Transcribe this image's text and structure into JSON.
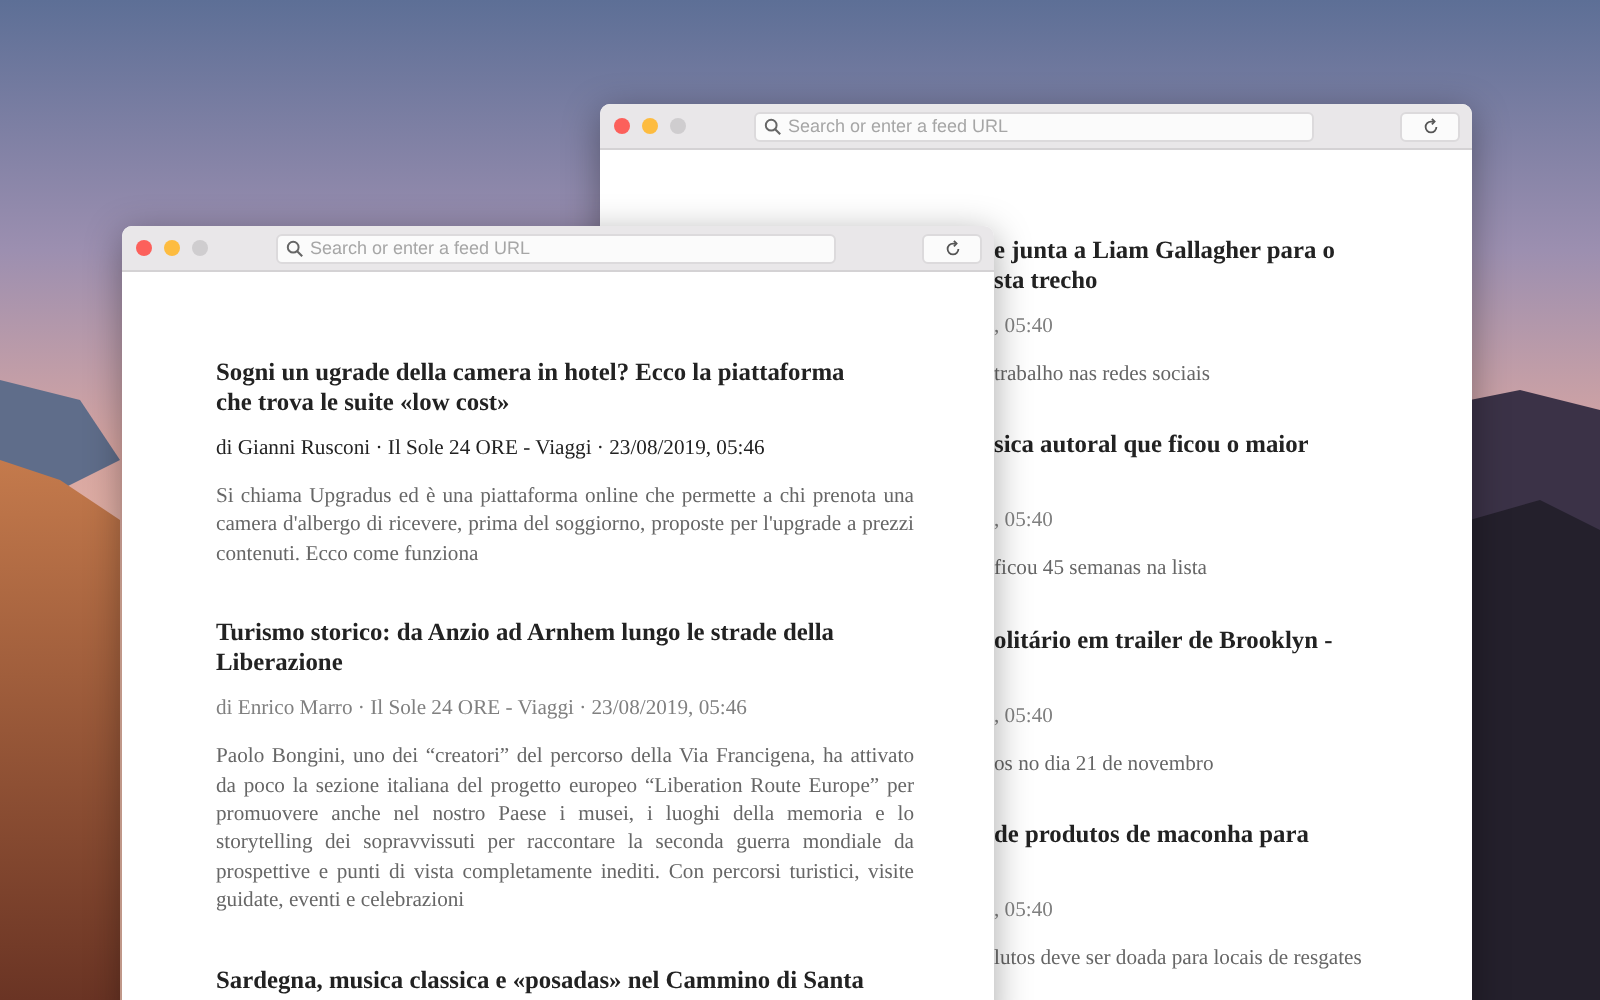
{
  "windows": [
    {
      "search": {
        "placeholder": "Search or enter a feed URL"
      },
      "articles": [
        {
          "title_lines": [
            "e junta a Liam Gallagher para o",
            "sta trecho"
          ],
          "meta": ", 05:40",
          "summary": "trabalho nas redes sociais"
        },
        {
          "title_lines": [
            "sica autoral que ficou o maior"
          ],
          "meta": ", 05:40",
          "summary": "ficou 45 semanas na lista"
        },
        {
          "title_lines": [
            "olitário em trailer de Brooklyn -"
          ],
          "meta": ", 05:40",
          "summary": "os no dia 21 de novembro"
        },
        {
          "title_lines": [
            "de produtos de maconha para"
          ],
          "meta": ", 05:40",
          "summary": "lutos deve ser doada para locais de resgates"
        }
      ]
    },
    {
      "search": {
        "placeholder": "Search or enter a feed URL"
      },
      "articles": [
        {
          "title_lines": [
            "Sogni un ugrade della camera in hotel? Ecco la piattaforma",
            "che trova le suite «low cost»"
          ],
          "meta": "di Gianni Rusconi · Il Sole 24 ORE - Viaggi · 23/08/2019, 05:46",
          "unread": true,
          "summary": "Si chiama Upgradus ed è una piattaforma online che permette a chi prenota una camera d'albergo di ricevere, prima del soggiorno, proposte per l'upgrade a prezzi contenuti. Ecco come funziona"
        },
        {
          "title_lines": [
            "Turismo storico: da Anzio ad Arnhem lungo le strade della",
            "Liberazione"
          ],
          "meta": "di Enrico Marro · Il Sole 24 ORE - Viaggi · 23/08/2019, 05:46",
          "unread": false,
          "summary": "Paolo Bongini, uno dei “creatori” del percorso della Via Francigena, ha attivato da poco la sezione italiana del progetto europeo “Liberation Route Europe” per promuovere anche nel nostro Paese i musei, i luoghi della memoria e lo storytelling dei sopravvissuti per raccontare la seconda guerra mondiale da prospettive e punti di vista completamente inediti. Con percorsi turistici, visite guidate, eventi e celebrazioni"
        },
        {
          "title_lines": [
            "Sardegna, musica classica e «posadas» nel Cammino di Santa"
          ]
        }
      ]
    }
  ]
}
